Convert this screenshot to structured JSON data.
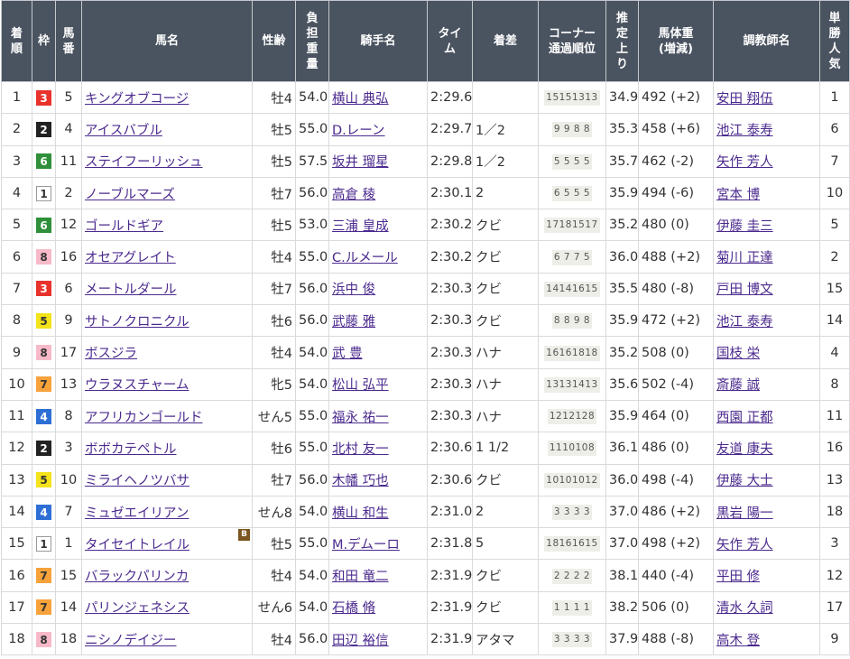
{
  "headers": {
    "rank": "着\n順",
    "waku": "枠",
    "umaban": "馬\n番",
    "horse": "馬名",
    "sexage": "性齢",
    "weight": "負\n担\n重\n量",
    "jockey": "騎手名",
    "time": "タイ\nム",
    "margin": "着差",
    "corner": "コーナー\n通過順位",
    "last3f": "推\n定\n上\nり",
    "bodyweight": "馬体重\n(増減)",
    "trainer": "調教師名",
    "pop": "単\n勝\n人\n気"
  },
  "blinker_label": "B",
  "waku_colors": {
    "1": {
      "bg": "#ffffff",
      "fg": "#333333",
      "border": "#999999"
    },
    "2": {
      "bg": "#222222",
      "fg": "#ffffff",
      "border": "#222222"
    },
    "3": {
      "bg": "#e8322b",
      "fg": "#ffffff",
      "border": "#e8322b"
    },
    "4": {
      "bg": "#2e6fd6",
      "fg": "#ffffff",
      "border": "#2e6fd6"
    },
    "5": {
      "bg": "#f4e31a",
      "fg": "#333333",
      "border": "#f4e31a"
    },
    "6": {
      "bg": "#2f8f3a",
      "fg": "#ffffff",
      "border": "#2f8f3a"
    },
    "7": {
      "bg": "#f7a23a",
      "fg": "#333333",
      "border": "#f7a23a"
    },
    "8": {
      "bg": "#f7b9c8",
      "fg": "#333333",
      "border": "#f7b9c8"
    }
  },
  "rows": [
    {
      "rank": "1",
      "waku": "3",
      "umaban": "5",
      "horse": "キングオブコージ",
      "sexage": "牡4",
      "weight": "54.0",
      "jockey": "横山 典弘",
      "time": "2:29.6",
      "margin": "",
      "corner": "15151313",
      "last3f": "34.9",
      "bodyweight": "492 (+2)",
      "trainer": "安田 翔伍",
      "pop": "1",
      "blinker": false
    },
    {
      "rank": "2",
      "waku": "2",
      "umaban": "4",
      "horse": "アイスバブル",
      "sexage": "牡5",
      "weight": "55.0",
      "jockey": "D.レーン",
      "time": "2:29.7",
      "margin": "1／2",
      "corner": "9 9 8 8",
      "last3f": "35.3",
      "bodyweight": "458 (+6)",
      "trainer": "池江 泰寿",
      "pop": "6",
      "blinker": false
    },
    {
      "rank": "3",
      "waku": "6",
      "umaban": "11",
      "horse": "ステイフーリッシュ",
      "sexage": "牡5",
      "weight": "57.5",
      "jockey": "坂井 瑠星",
      "time": "2:29.8",
      "margin": "1／2",
      "corner": "5 5 5 5",
      "last3f": "35.7",
      "bodyweight": "462 (-2)",
      "trainer": "矢作 芳人",
      "pop": "7",
      "blinker": false
    },
    {
      "rank": "4",
      "waku": "1",
      "umaban": "2",
      "horse": "ノーブルマーズ",
      "sexage": "牡7",
      "weight": "56.0",
      "jockey": "高倉 稜",
      "time": "2:30.1",
      "margin": "2",
      "corner": "6 5 5 5",
      "last3f": "35.9",
      "bodyweight": "494 (-6)",
      "trainer": "宮本 博",
      "pop": "10",
      "blinker": false
    },
    {
      "rank": "5",
      "waku": "6",
      "umaban": "12",
      "horse": "ゴールドギア",
      "sexage": "牡5",
      "weight": "53.0",
      "jockey": "三浦 皇成",
      "time": "2:30.2",
      "margin": "クビ",
      "corner": "17181517",
      "last3f": "35.2",
      "bodyweight": "480 (0)",
      "trainer": "伊藤 圭三",
      "pop": "5",
      "blinker": false
    },
    {
      "rank": "6",
      "waku": "8",
      "umaban": "16",
      "horse": "オセアグレイト",
      "sexage": "牡4",
      "weight": "55.0",
      "jockey": "C.ルメール",
      "time": "2:30.2",
      "margin": "クビ",
      "corner": "6 7 7 5",
      "last3f": "36.0",
      "bodyweight": "488 (+2)",
      "trainer": "菊川 正達",
      "pop": "2",
      "blinker": false
    },
    {
      "rank": "7",
      "waku": "3",
      "umaban": "6",
      "horse": "メートルダール",
      "sexage": "牡7",
      "weight": "56.0",
      "jockey": "浜中 俊",
      "time": "2:30.3",
      "margin": "クビ",
      "corner": "14141615",
      "last3f": "35.5",
      "bodyweight": "480 (-8)",
      "trainer": "戸田 博文",
      "pop": "15",
      "blinker": false
    },
    {
      "rank": "8",
      "waku": "5",
      "umaban": "9",
      "horse": "サトノクロニクル",
      "sexage": "牡6",
      "weight": "56.0",
      "jockey": "武藤 雅",
      "time": "2:30.3",
      "margin": "クビ",
      "corner": "8 8 9 8",
      "last3f": "35.9",
      "bodyweight": "472 (+2)",
      "trainer": "池江 泰寿",
      "pop": "14",
      "blinker": false
    },
    {
      "rank": "9",
      "waku": "8",
      "umaban": "17",
      "horse": "ボスジラ",
      "sexage": "牡4",
      "weight": "54.0",
      "jockey": "武 豊",
      "time": "2:30.3",
      "margin": "ハナ",
      "corner": "16161818",
      "last3f": "35.2",
      "bodyweight": "508 (0)",
      "trainer": "国枝 栄",
      "pop": "4",
      "blinker": false
    },
    {
      "rank": "10",
      "waku": "7",
      "umaban": "13",
      "horse": "ウラヌスチャーム",
      "sexage": "牝5",
      "weight": "54.0",
      "jockey": "松山 弘平",
      "time": "2:30.3",
      "margin": "ハナ",
      "corner": "13131413",
      "last3f": "35.6",
      "bodyweight": "502 (-4)",
      "trainer": "斎藤 誠",
      "pop": "8",
      "blinker": false
    },
    {
      "rank": "11",
      "waku": "4",
      "umaban": "8",
      "horse": "アフリカンゴールド",
      "sexage": "せん5",
      "weight": "55.0",
      "jockey": "福永 祐一",
      "time": "2:30.3",
      "margin": "ハナ",
      "corner": "1212128",
      "last3f": "35.9",
      "bodyweight": "464 (0)",
      "trainer": "西園 正都",
      "pop": "11",
      "blinker": false
    },
    {
      "rank": "12",
      "waku": "2",
      "umaban": "3",
      "horse": "ボボカテペトル",
      "sexage": "牡6",
      "weight": "55.0",
      "jockey": "北村 友一",
      "time": "2:30.6",
      "margin": "1 1/2",
      "corner": "1110108",
      "last3f": "36.1",
      "bodyweight": "486 (0)",
      "trainer": "友道 康夫",
      "pop": "16",
      "blinker": false
    },
    {
      "rank": "13",
      "waku": "5",
      "umaban": "10",
      "horse": "ミライヘノツバサ",
      "sexage": "牡7",
      "weight": "56.0",
      "jockey": "木幡 巧也",
      "time": "2:30.6",
      "margin": "クビ",
      "corner": "10101012",
      "last3f": "36.0",
      "bodyweight": "498 (-4)",
      "trainer": "伊藤 大士",
      "pop": "13",
      "blinker": false
    },
    {
      "rank": "14",
      "waku": "4",
      "umaban": "7",
      "horse": "ミュゼエイリアン",
      "sexage": "せん8",
      "weight": "54.0",
      "jockey": "横山 和生",
      "time": "2:31.0",
      "margin": "2",
      "corner": "3 3 3 3",
      "last3f": "37.0",
      "bodyweight": "486 (+2)",
      "trainer": "黒岩 陽一",
      "pop": "18",
      "blinker": false
    },
    {
      "rank": "15",
      "waku": "1",
      "umaban": "1",
      "horse": "タイセイトレイル",
      "sexage": "牡5",
      "weight": "55.0",
      "jockey": "M.デムーロ",
      "time": "2:31.8",
      "margin": "5",
      "corner": "18161615",
      "last3f": "37.0",
      "bodyweight": "498 (+2)",
      "trainer": "矢作 芳人",
      "pop": "3",
      "blinker": true
    },
    {
      "rank": "16",
      "waku": "7",
      "umaban": "15",
      "horse": "バラックパリンカ",
      "sexage": "牡4",
      "weight": "54.0",
      "jockey": "和田 竜二",
      "time": "2:31.9",
      "margin": "クビ",
      "corner": "2 2 2 2",
      "last3f": "38.1",
      "bodyweight": "440 (-4)",
      "trainer": "平田 修",
      "pop": "12",
      "blinker": false
    },
    {
      "rank": "17",
      "waku": "7",
      "umaban": "14",
      "horse": "パリンジェネシス",
      "sexage": "せん6",
      "weight": "54.0",
      "jockey": "石橋 脩",
      "time": "2:31.9",
      "margin": "クビ",
      "corner": "1 1 1 1",
      "last3f": "38.2",
      "bodyweight": "506 (0)",
      "trainer": "清水 久詞",
      "pop": "17",
      "blinker": false
    },
    {
      "rank": "18",
      "waku": "8",
      "umaban": "18",
      "horse": "ニシノデイジー",
      "sexage": "牡4",
      "weight": "56.0",
      "jockey": "田辺 裕信",
      "time": "2:31.9",
      "margin": "アタマ",
      "corner": "3 3 3 3",
      "last3f": "37.9",
      "bodyweight": "488 (-8)",
      "trainer": "高木 登",
      "pop": "9",
      "blinker": false
    }
  ]
}
